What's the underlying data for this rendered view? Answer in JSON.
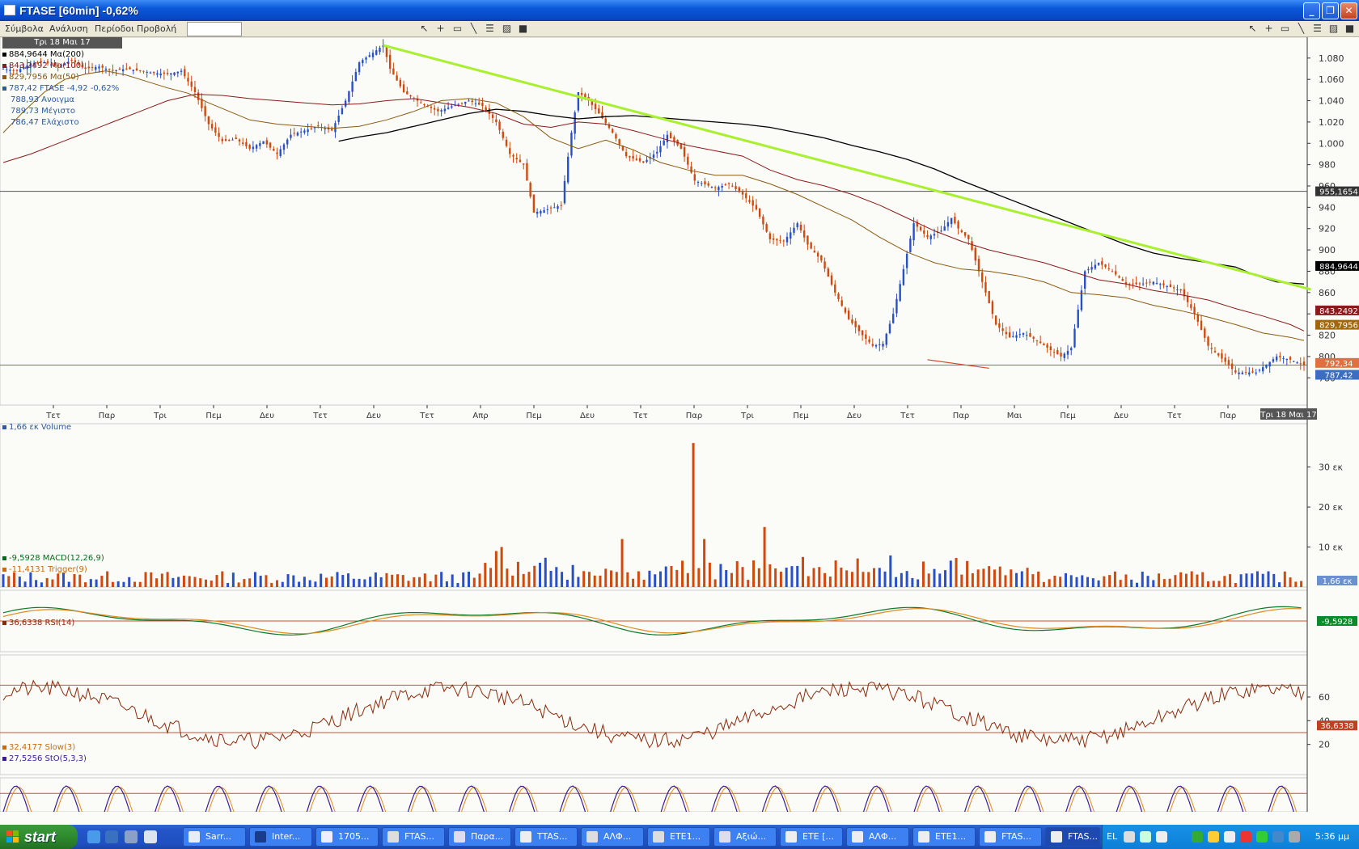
{
  "window": {
    "title": "FTASE [60min] -0,62%"
  },
  "menu": {
    "items": [
      "Σύμβολα",
      "Ανάλυση",
      "Περίοδοι",
      "Προβολή"
    ],
    "symbol_input_value": ""
  },
  "main_panel": {
    "date_badge": "Τρι 18 Μαι 17",
    "legend": [
      {
        "text": "884,9644 Μα(200)",
        "color": "#000000"
      },
      {
        "text": "843,2492 Μα(100)",
        "color": "#8b1a1a"
      },
      {
        "text": "829,7956 Μα(50)",
        "color": "#8b5a10"
      },
      {
        "text": "787,42 FTASE -4,92 -0,62%",
        "color": "#2a5aa0",
        "change_color": "#d04010"
      },
      {
        "text": "788,93 Ανοιγμα",
        "color": "#2a5aa0"
      },
      {
        "text": "789,73 Μέγιστο",
        "color": "#2a5aa0"
      },
      {
        "text": "786,47 Ελάχιστο",
        "color": "#2a5aa0"
      }
    ],
    "x_ticks": [
      "Τετ",
      "Παρ",
      "Τρι",
      "Πεμ",
      "Δευ",
      "Τετ",
      "Δευ",
      "Τετ",
      "Απρ",
      "Πεμ",
      "Δευ",
      "Τετ",
      "Παρ",
      "Τρι",
      "Πεμ",
      "Δευ",
      "Τετ",
      "Παρ",
      "Μαι",
      "Πεμ",
      "Δευ",
      "Τετ",
      "Παρ"
    ],
    "x_end_label": "Τρι 18 Μαι 17",
    "price_tags": [
      {
        "text": "955,1654",
        "bg": "#333333"
      },
      {
        "text": "884,9644",
        "bg": "#000000"
      },
      {
        "text": "843,2492",
        "bg": "#8b1a1a"
      },
      {
        "text": "829,7956",
        "bg": "#a0680a"
      },
      {
        "text": "792,34",
        "bg": "#e07040"
      },
      {
        "text": "787,42",
        "bg": "#3a6ec0"
      }
    ]
  },
  "volume_panel": {
    "legend": "1,66 εκ Volume",
    "current_tag": "1,66 εκ"
  },
  "macd_panel": {
    "legend_macd": "-9,5928 MACD(12,26,9)",
    "legend_trigger": "-11,4131 Trigger(9)",
    "current_tag": "-9,5928"
  },
  "rsi_panel": {
    "legend": "36,6338 RSI(14)",
    "current_tag": "36,6338"
  },
  "stoch_panel": {
    "legend_slow": "32,4177 Slow(3)",
    "legend_sto": "27,5256 StO(5,3,3)",
    "current_tag": "27,5256"
  },
  "chart_data": [
    {
      "type": "candlestick",
      "title": "FTASE [60min]",
      "y_ticks": [
        780,
        800,
        820,
        840,
        860,
        880,
        900,
        920,
        940,
        960,
        980,
        1000,
        1020,
        1040,
        1060,
        1080
      ],
      "y_tick_labels": [
        "780",
        "800",
        "820",
        "",
        "860",
        "880",
        "900",
        "920",
        "940",
        "960",
        "980",
        "1.000",
        "1.020",
        "1.040",
        "1.060",
        "1.080"
      ],
      "ylim": [
        762,
        1092
      ],
      "close_path": [
        [
          0,
          1070
        ],
        [
          20,
          1068
        ],
        [
          40,
          1075
        ],
        [
          60,
          1076
        ],
        [
          80,
          1072
        ],
        [
          100,
          1078
        ],
        [
          120,
          1070
        ],
        [
          140,
          1072
        ],
        [
          160,
          1068
        ],
        [
          180,
          1070
        ],
        [
          200,
          1068
        ],
        [
          220,
          1066
        ],
        [
          240,
          1065
        ],
        [
          260,
          1068
        ],
        [
          280,
          1048
        ],
        [
          300,
          1018
        ],
        [
          320,
          1002
        ],
        [
          340,
          1004
        ],
        [
          360,
          995
        ],
        [
          380,
          1002
        ],
        [
          400,
          990
        ],
        [
          420,
          1008
        ],
        [
          440,
          1012
        ],
        [
          460,
          1016
        ],
        [
          480,
          1012
        ],
        [
          500,
          1040
        ],
        [
          520,
          1076
        ],
        [
          540,
          1085
        ],
        [
          555,
          1092
        ],
        [
          565,
          1070
        ],
        [
          585,
          1048
        ],
        [
          610,
          1038
        ],
        [
          635,
          1030
        ],
        [
          660,
          1036
        ],
        [
          680,
          1040
        ],
        [
          700,
          1035
        ],
        [
          720,
          1020
        ],
        [
          740,
          990
        ],
        [
          760,
          980
        ],
        [
          775,
          935
        ],
        [
          795,
          938
        ],
        [
          815,
          942
        ],
        [
          830,
          1010
        ],
        [
          840,
          1048
        ],
        [
          855,
          1040
        ],
        [
          870,
          1028
        ],
        [
          890,
          1010
        ],
        [
          910,
          988
        ],
        [
          935,
          982
        ],
        [
          955,
          992
        ],
        [
          970,
          1008
        ],
        [
          990,
          995
        ],
        [
          1010,
          965
        ],
        [
          1040,
          958
        ],
        [
          1060,
          962
        ],
        [
          1080,
          952
        ],
        [
          1100,
          938
        ],
        [
          1120,
          910
        ],
        [
          1140,
          908
        ],
        [
          1160,
          925
        ],
        [
          1175,
          905
        ],
        [
          1195,
          890
        ],
        [
          1215,
          860
        ],
        [
          1235,
          835
        ],
        [
          1255,
          820
        ],
        [
          1270,
          810
        ],
        [
          1285,
          812
        ],
        [
          1300,
          840
        ],
        [
          1315,
          882
        ],
        [
          1330,
          925
        ],
        [
          1350,
          912
        ],
        [
          1370,
          918
        ],
        [
          1385,
          930
        ],
        [
          1395,
          920
        ],
        [
          1410,
          910
        ],
        [
          1430,
          870
        ],
        [
          1450,
          830
        ],
        [
          1470,
          818
        ],
        [
          1490,
          822
        ],
        [
          1510,
          815
        ],
        [
          1530,
          806
        ],
        [
          1545,
          800
        ],
        [
          1560,
          808
        ],
        [
          1580,
          880
        ],
        [
          1600,
          888
        ],
        [
          1620,
          880
        ],
        [
          1640,
          868
        ],
        [
          1660,
          868
        ],
        [
          1680,
          870
        ],
        [
          1700,
          866
        ],
        [
          1720,
          862
        ],
        [
          1740,
          840
        ],
        [
          1760,
          810
        ],
        [
          1785,
          795
        ],
        [
          1800,
          785
        ],
        [
          1830,
          785
        ],
        [
          1860,
          800
        ],
        [
          1880,
          797
        ],
        [
          1900,
          792
        ]
      ],
      "ma200_path": [
        [
          490,
          1002
        ],
        [
          520,
          1006
        ],
        [
          560,
          1010
        ],
        [
          600,
          1016
        ],
        [
          640,
          1022
        ],
        [
          680,
          1028
        ],
        [
          720,
          1032
        ],
        [
          760,
          1030
        ],
        [
          800,
          1026
        ],
        [
          840,
          1023
        ],
        [
          880,
          1025
        ],
        [
          920,
          1026
        ],
        [
          960,
          1024
        ],
        [
          1000,
          1022
        ],
        [
          1040,
          1020
        ],
        [
          1080,
          1018
        ],
        [
          1120,
          1015
        ],
        [
          1160,
          1010
        ],
        [
          1200,
          1005
        ],
        [
          1240,
          998
        ],
        [
          1280,
          992
        ],
        [
          1320,
          985
        ],
        [
          1360,
          976
        ],
        [
          1400,
          965
        ],
        [
          1440,
          955
        ],
        [
          1480,
          945
        ],
        [
          1520,
          935
        ],
        [
          1560,
          925
        ],
        [
          1600,
          915
        ],
        [
          1640,
          905
        ],
        [
          1680,
          897
        ],
        [
          1720,
          892
        ],
        [
          1760,
          888
        ],
        [
          1800,
          884
        ],
        [
          1830,
          876
        ],
        [
          1860,
          870
        ],
        [
          1900,
          868
        ]
      ],
      "ma100_path": [
        [
          0,
          982
        ],
        [
          40,
          990
        ],
        [
          80,
          1000
        ],
        [
          120,
          1010
        ],
        [
          160,
          1020
        ],
        [
          200,
          1030
        ],
        [
          240,
          1040
        ],
        [
          280,
          1046
        ],
        [
          320,
          1045
        ],
        [
          360,
          1042
        ],
        [
          400,
          1040
        ],
        [
          440,
          1038
        ],
        [
          480,
          1036
        ],
        [
          520,
          1037
        ],
        [
          560,
          1040
        ],
        [
          600,
          1042
        ],
        [
          640,
          1038
        ],
        [
          680,
          1034
        ],
        [
          720,
          1028
        ],
        [
          760,
          1018
        ],
        [
          800,
          1015
        ],
        [
          840,
          1020
        ],
        [
          880,
          1018
        ],
        [
          920,
          1012
        ],
        [
          960,
          1005
        ],
        [
          1000,
          998
        ],
        [
          1040,
          993
        ],
        [
          1080,
          988
        ],
        [
          1120,
          975
        ],
        [
          1160,
          966
        ],
        [
          1200,
          960
        ],
        [
          1240,
          952
        ],
        [
          1280,
          942
        ],
        [
          1320,
          930
        ],
        [
          1360,
          918
        ],
        [
          1400,
          908
        ],
        [
          1440,
          900
        ],
        [
          1480,
          894
        ],
        [
          1520,
          888
        ],
        [
          1560,
          880
        ],
        [
          1600,
          872
        ],
        [
          1640,
          868
        ],
        [
          1680,
          862
        ],
        [
          1720,
          858
        ],
        [
          1760,
          853
        ],
        [
          1800,
          845
        ],
        [
          1840,
          838
        ],
        [
          1880,
          830
        ],
        [
          1900,
          824
        ]
      ],
      "ma50_path": [
        [
          0,
          1010
        ],
        [
          30,
          1030
        ],
        [
          60,
          1048
        ],
        [
          90,
          1060
        ],
        [
          120,
          1065
        ],
        [
          150,
          1068
        ],
        [
          180,
          1064
        ],
        [
          210,
          1058
        ],
        [
          240,
          1052
        ],
        [
          270,
          1047
        ],
        [
          300,
          1038
        ],
        [
          330,
          1030
        ],
        [
          360,
          1022
        ],
        [
          400,
          1018
        ],
        [
          440,
          1016
        ],
        [
          480,
          1014
        ],
        [
          520,
          1016
        ],
        [
          560,
          1022
        ],
        [
          600,
          1030
        ],
        [
          640,
          1040
        ],
        [
          680,
          1042
        ],
        [
          720,
          1038
        ],
        [
          760,
          1025
        ],
        [
          800,
          1005
        ],
        [
          840,
          995
        ],
        [
          880,
          1003
        ],
        [
          920,
          994
        ],
        [
          960,
          982
        ],
        [
          1000,
          975
        ],
        [
          1040,
          970
        ],
        [
          1080,
          970
        ],
        [
          1120,
          962
        ],
        [
          1160,
          952
        ],
        [
          1200,
          940
        ],
        [
          1240,
          928
        ],
        [
          1280,
          912
        ],
        [
          1320,
          898
        ],
        [
          1360,
          888
        ],
        [
          1400,
          882
        ],
        [
          1440,
          880
        ],
        [
          1480,
          876
        ],
        [
          1520,
          870
        ],
        [
          1560,
          860
        ],
        [
          1600,
          858
        ],
        [
          1640,
          855
        ],
        [
          1680,
          848
        ],
        [
          1720,
          843
        ],
        [
          1760,
          837
        ],
        [
          1800,
          830
        ],
        [
          1840,
          822
        ],
        [
          1880,
          818
        ],
        [
          1900,
          815
        ]
      ],
      "trendline": [
        [
          555,
          1092
        ],
        [
          1910,
          863
        ]
      ],
      "support_line": 792,
      "hline": 955
    }
  ]
}
